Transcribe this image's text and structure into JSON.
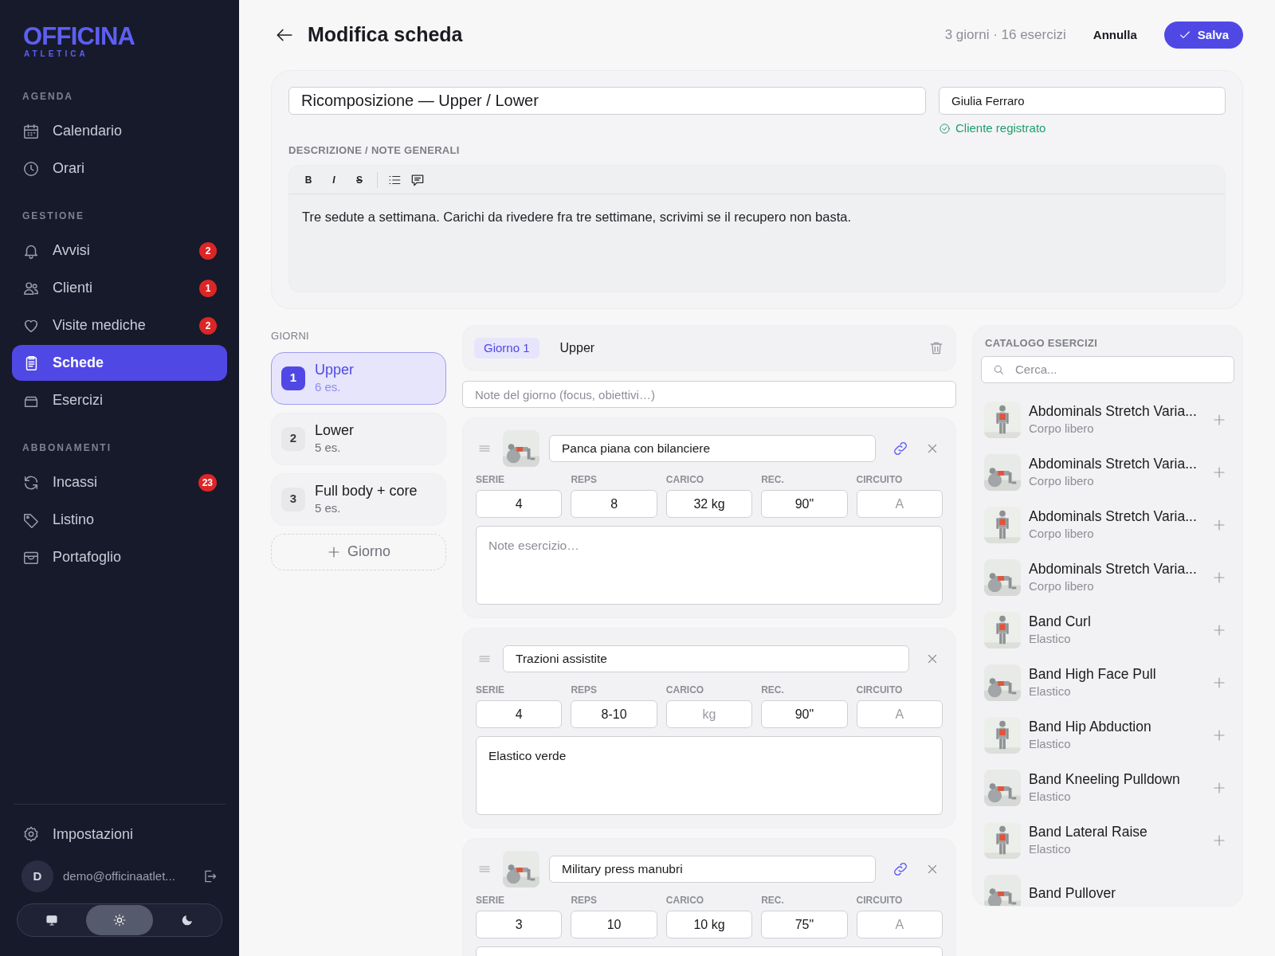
{
  "sidebar": {
    "logo": {
      "title": "OFFICINA",
      "subtitle": "ATLETICA"
    },
    "sections": [
      {
        "label": "AGENDA",
        "items": [
          {
            "label": "Calendario",
            "selected": false
          },
          {
            "label": "Orari",
            "selected": false
          }
        ]
      },
      {
        "label": "GESTIONE",
        "items": [
          {
            "label": "Avvisi",
            "badge": "2",
            "selected": false
          },
          {
            "label": "Clienti",
            "badge": "1",
            "selected": false
          },
          {
            "label": "Visite mediche",
            "badge": "2",
            "selected": false
          },
          {
            "label": "Schede",
            "selected": true
          },
          {
            "label": "Esercizi",
            "selected": false
          }
        ]
      },
      {
        "label": "ABBONAMENTI",
        "items": [
          {
            "label": "Incassi",
            "badge": "23",
            "selected": false
          },
          {
            "label": "Listino",
            "selected": false
          },
          {
            "label": "Portafoglio",
            "selected": false
          }
        ]
      }
    ],
    "settings": "Impostazioni",
    "user": {
      "initial": "D",
      "email": "demo@officinaatlet..."
    },
    "theme_modes": [
      {
        "kind": "monitor",
        "selected": false
      },
      {
        "kind": "sun",
        "selected": true
      },
      {
        "kind": "moon",
        "selected": false
      }
    ]
  },
  "header": {
    "title": "Modifica scheda",
    "summary": "3 giorni · 16 esercizi",
    "cancel": "Annulla",
    "save": "Salva"
  },
  "plan": {
    "name": "Ricomposizione — Upper / Lower",
    "client": "Giulia Ferraro",
    "client_status": "Cliente registrato",
    "description_label": "DESCRIZIONE / NOTE GENERALI",
    "toolbar": [
      "B",
      "I",
      "S"
    ],
    "description": "Tre sedute a settimana. Carichi da rivedere fra tre settimane, scrivimi se il recupero non basta."
  },
  "days": {
    "label": "GIORNI",
    "items": [
      {
        "number": "1",
        "name": "Upper",
        "count": "6 es.",
        "selected": true
      },
      {
        "number": "2",
        "name": "Lower",
        "count": "5 es.",
        "selected": false
      },
      {
        "number": "3",
        "name": "Full body + core",
        "count": "5 es.",
        "selected": false
      }
    ],
    "add": "Giorno"
  },
  "day_editor": {
    "tag": "Giorno 1",
    "name": "Upper",
    "notes_placeholder": "Note del giorno (focus, obiettivi…)"
  },
  "exercises": [
    {
      "kind": "catalog",
      "name": "Panca piana con bilanciere",
      "fields": [
        {
          "label": "SERIE",
          "value": "4"
        },
        {
          "label": "REPS",
          "value": "8"
        },
        {
          "label": "CARICO",
          "value": "32 kg"
        },
        {
          "label": "REC.",
          "value": "90\""
        },
        {
          "label": "CIRCUITO",
          "placeholder": "A"
        }
      ],
      "notes": {
        "placeholder": "Note esercizio…"
      }
    },
    {
      "kind": "custom",
      "name": "Trazioni assistite",
      "fields": [
        {
          "label": "SERIE",
          "value": "4"
        },
        {
          "label": "REPS",
          "value": "8-10"
        },
        {
          "label": "CARICO",
          "placeholder": "kg"
        },
        {
          "label": "REC.",
          "value": "90\""
        },
        {
          "label": "CIRCUITO",
          "placeholder": "A"
        }
      ],
      "notes": {
        "value": "Elastico verde"
      }
    },
    {
      "kind": "catalog",
      "name": "Military press manubri",
      "fields": [
        {
          "label": "SERIE",
          "value": "3"
        },
        {
          "label": "REPS",
          "value": "10"
        },
        {
          "label": "CARICO",
          "value": "10 kg"
        },
        {
          "label": "REC.",
          "value": "75\""
        },
        {
          "label": "CIRCUITO",
          "placeholder": "A"
        }
      ]
    }
  ],
  "catalog": {
    "label": "CATALOGO ESERCIZI",
    "search_placeholder": "Cerca...",
    "items": [
      {
        "name": "Abdominals Stretch Varia...",
        "category": "Corpo libero"
      },
      {
        "name": "Abdominals Stretch Varia...",
        "category": "Corpo libero"
      },
      {
        "name": "Abdominals Stretch Varia...",
        "category": "Corpo libero"
      },
      {
        "name": "Abdominals Stretch Varia...",
        "category": "Corpo libero"
      },
      {
        "name": "Band Curl",
        "category": "Elastico"
      },
      {
        "name": "Band High Face Pull",
        "category": "Elastico"
      },
      {
        "name": "Band Hip Abduction",
        "category": "Elastico"
      },
      {
        "name": "Band Kneeling Pulldown",
        "category": "Elastico"
      },
      {
        "name": "Band Lateral Raise",
        "category": "Elastico"
      },
      {
        "name": "Band Pullover"
      }
    ]
  }
}
